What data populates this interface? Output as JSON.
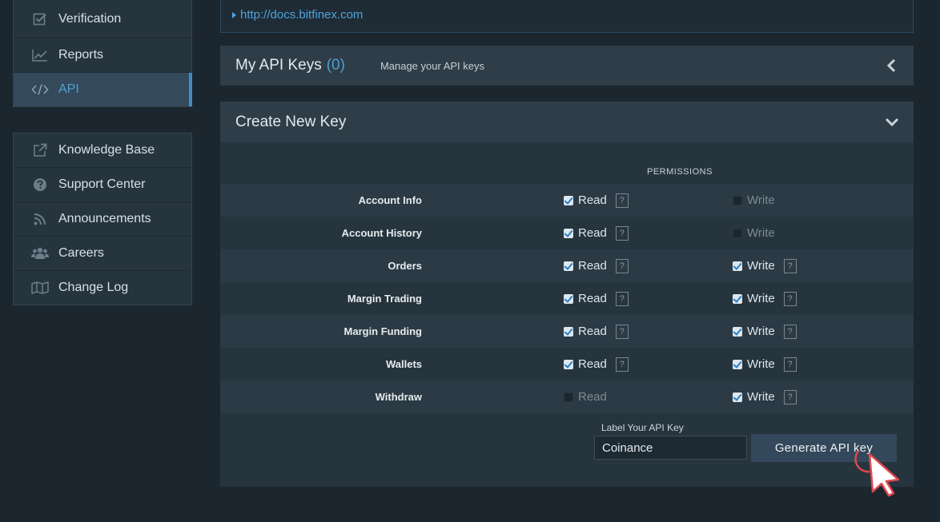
{
  "sidebar": {
    "group1": [
      {
        "label": "Verification",
        "icon": "checkbox-icon"
      },
      {
        "label": "Reports",
        "icon": "chart-line-icon"
      },
      {
        "label": "API",
        "icon": "code-icon",
        "active": true
      }
    ],
    "group2": [
      {
        "label": "Knowledge Base",
        "icon": "external-link-icon"
      },
      {
        "label": "Support Center",
        "icon": "question-circle-icon"
      },
      {
        "label": "Announcements",
        "icon": "rss-icon"
      },
      {
        "label": "Careers",
        "icon": "users-icon"
      },
      {
        "label": "Change Log",
        "icon": "map-icon"
      }
    ]
  },
  "docs": {
    "link": "http://docs.bitfinex.com"
  },
  "api_keys": {
    "title": "My API Keys",
    "count": "(0)",
    "subtitle": "Manage your API keys"
  },
  "create_key": {
    "title": "Create New Key",
    "permissions_header": "PERMISSIONS",
    "rows": [
      {
        "label": "Account Info",
        "read": true,
        "read_help": true,
        "write": false,
        "write_help": false
      },
      {
        "label": "Account History",
        "read": true,
        "read_help": true,
        "write": false,
        "write_help": false
      },
      {
        "label": "Orders",
        "read": true,
        "read_help": true,
        "write": true,
        "write_help": true
      },
      {
        "label": "Margin Trading",
        "read": true,
        "read_help": true,
        "write": true,
        "write_help": true
      },
      {
        "label": "Margin Funding",
        "read": true,
        "read_help": true,
        "write": true,
        "write_help": true
      },
      {
        "label": "Wallets",
        "read": true,
        "read_help": true,
        "write": true,
        "write_help": true
      },
      {
        "label": "Withdraw",
        "read": false,
        "read_help": false,
        "write": true,
        "write_help": true
      }
    ],
    "read_label": "Read",
    "write_label": "Write",
    "help_mark": "?",
    "label_caption": "Label Your API Key",
    "label_value": "Coinance",
    "generate_button": "Generate API key"
  },
  "colors": {
    "accent": "#4da3dc",
    "background": "#1b262f",
    "panel": "#26343e",
    "cursor": "#e0474c"
  }
}
